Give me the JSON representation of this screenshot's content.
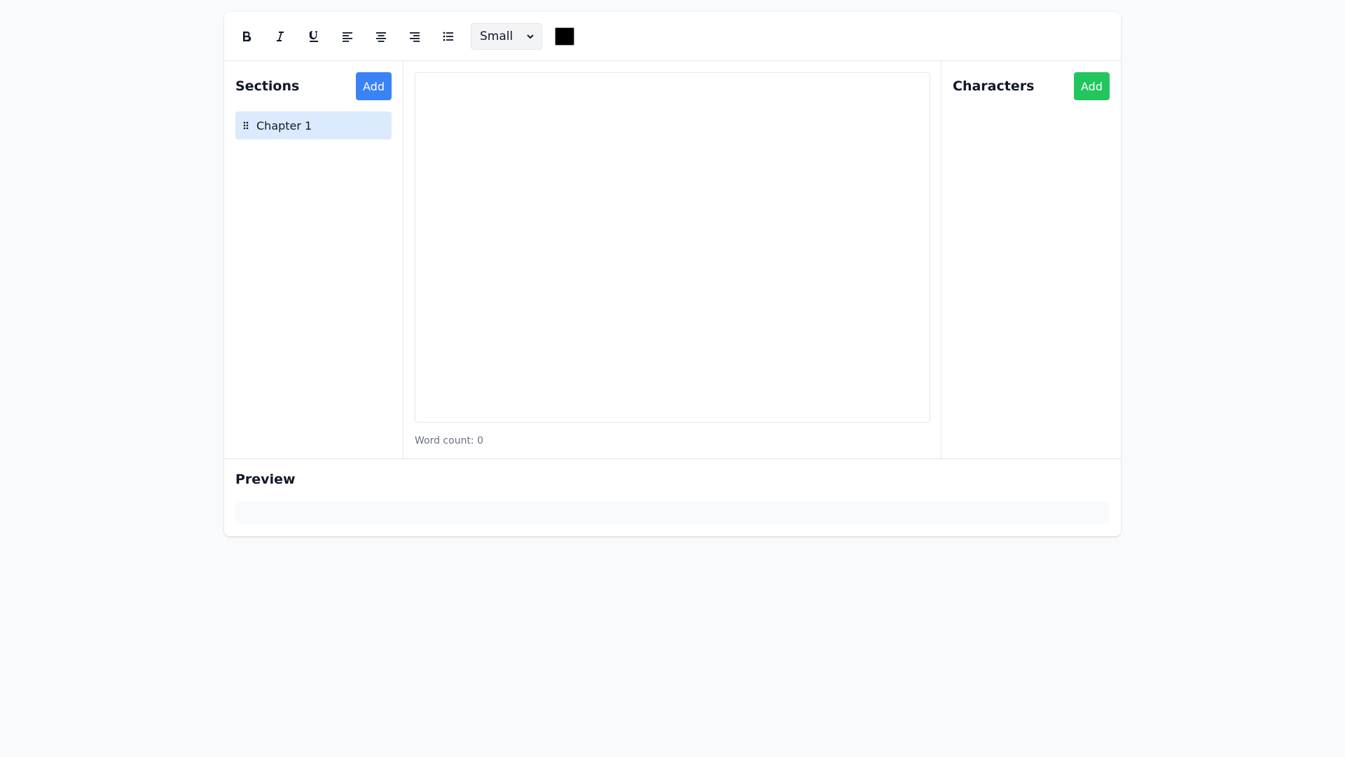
{
  "toolbar": {
    "buttons": [
      {
        "name": "bold",
        "icon": "bold-icon"
      },
      {
        "name": "italic",
        "icon": "italic-icon"
      },
      {
        "name": "underline",
        "icon": "underline-icon"
      },
      {
        "name": "align-left",
        "icon": "align-left-icon"
      },
      {
        "name": "align-center",
        "icon": "align-center-icon"
      },
      {
        "name": "align-right",
        "icon": "align-right-icon"
      },
      {
        "name": "bullet-list",
        "icon": "list-icon"
      }
    ],
    "font_size": {
      "selected": "Small"
    },
    "text_color": "#000000"
  },
  "sections": {
    "title": "Sections",
    "add_label": "Add",
    "items": [
      {
        "label": "Chapter 1",
        "active": true
      }
    ]
  },
  "editor": {
    "content": "",
    "word_count_label": "Word count: 0"
  },
  "characters": {
    "title": "Characters",
    "add_label": "Add",
    "items": []
  },
  "preview": {
    "title": "Preview",
    "content": ""
  },
  "colors": {
    "primary": "#3b82f6",
    "success": "#22c55e",
    "active_item_bg": "#dbeafe"
  }
}
